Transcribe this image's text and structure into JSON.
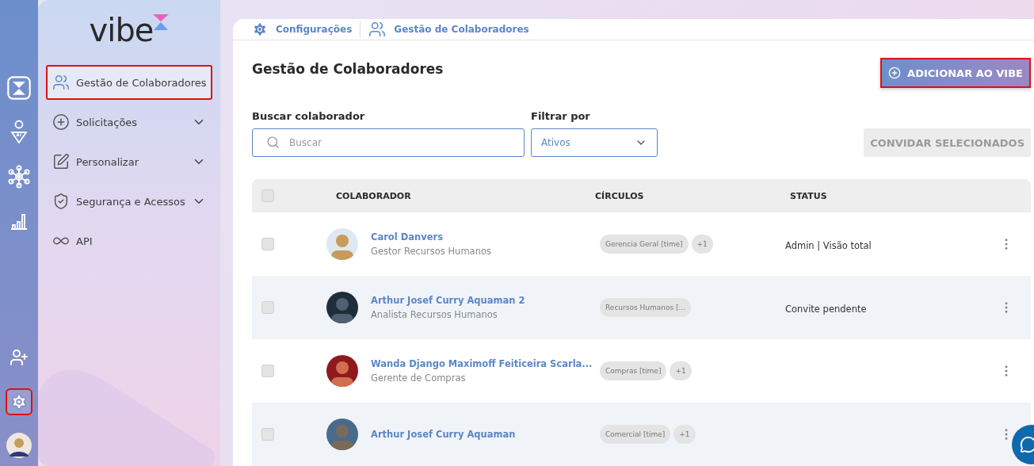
{
  "rail": {
    "items": [
      {
        "kind": "logo",
        "highlighted": false
      },
      {
        "kind": "ai-profile",
        "highlighted": false
      },
      {
        "kind": "network",
        "highlighted": false
      },
      {
        "kind": "chart",
        "highlighted": false
      },
      {
        "kind": "add-user",
        "highlighted": false
      },
      {
        "kind": "settings",
        "highlighted": true
      }
    ]
  },
  "sidebar": {
    "brand": "vibe",
    "items": [
      {
        "label": "Gestão de Colaboradores",
        "expandable": false,
        "highlighted": true
      },
      {
        "label": "Solicitações",
        "expandable": true,
        "highlighted": false
      },
      {
        "label": "Personalizar",
        "expandable": true,
        "highlighted": false
      },
      {
        "label": "Segurança e Acessos",
        "expandable": true,
        "highlighted": false
      },
      {
        "label": "API",
        "expandable": false,
        "highlighted": false
      }
    ]
  },
  "breadcrumb": [
    {
      "label": "Configurações"
    },
    {
      "label": "Gestão de Colaboradores"
    }
  ],
  "title": "Gestão de Colaboradores",
  "add_button": {
    "label": "ADICIONAR AO VIBE",
    "highlighted": true
  },
  "search": {
    "label": "Buscar colaborador",
    "placeholder": "Buscar"
  },
  "filter": {
    "label": "Filtrar por",
    "value": "Ativos"
  },
  "invite_button": {
    "label": "CONVIDAR SELECIONADOS",
    "disabled": true
  },
  "table": {
    "all_checked": false,
    "columns": [
      "COLABORADOR",
      "CÍRCULOS",
      "STATUS"
    ],
    "rows": [
      {
        "checked": false,
        "name": "Carol Danvers",
        "role": "Gestor Recursos Humanos",
        "circles": [
          "Gerencia Geral [time]",
          "+1"
        ],
        "status": "Admin | Visão total"
      },
      {
        "checked": false,
        "name": "Arthur Josef Curry Aquaman 2",
        "role": "Analista Recursos Humanos",
        "circles": [
          "Recursos Humanos [..."
        ],
        "status": "Convite pendente"
      },
      {
        "checked": false,
        "name": "Wanda Django Maximoff Feiticeira Scarla...",
        "role": "Gerente de Compras",
        "circles": [
          "Compras [time]",
          "+1"
        ]
      },
      {
        "checked": false,
        "name": "Arthur Josef Curry Aquaman",
        "circles": [
          "Comercial [time]",
          "+1"
        ]
      }
    ]
  }
}
